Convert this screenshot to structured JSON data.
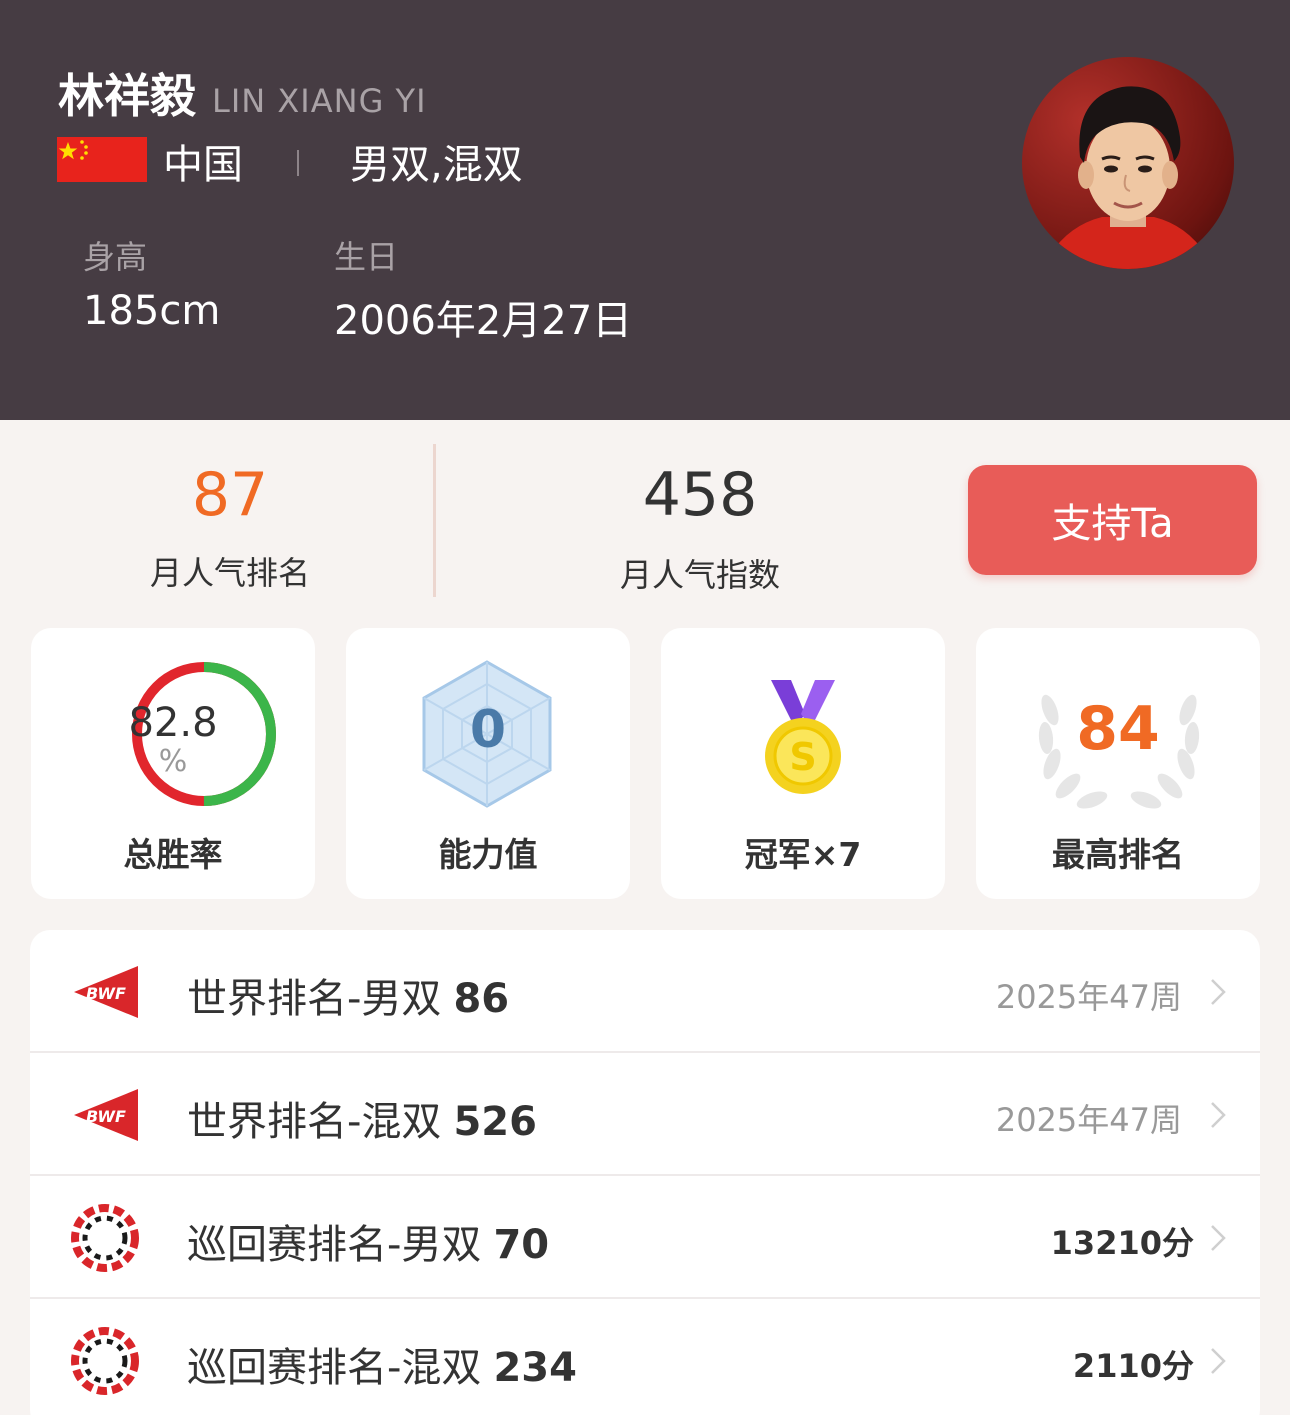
{
  "player": {
    "name_cn": "林祥毅",
    "name_en": "LIN XIANG YI",
    "country": "中国",
    "separator": "|",
    "events": "男双,混双",
    "height_label": "身高",
    "height_value": "185cm",
    "birthday_label": "生日",
    "birthday_value": "2006年2月27日"
  },
  "popularity": {
    "rank_value": "87",
    "rank_label": "月人气排名",
    "index_value": "458",
    "index_label": "月人气指数",
    "support_button": "支持Ta"
  },
  "stats": {
    "win_rate": {
      "value": "82.8",
      "unit": "%",
      "label": "总胜率",
      "fraction": 0.828
    },
    "ability": {
      "value": "0",
      "label": "能力值"
    },
    "champion": {
      "medal_letter": "S",
      "label": "冠军×7"
    },
    "best_rank": {
      "value": "84",
      "label": "最高排名"
    }
  },
  "rankings": [
    {
      "icon": "bwf-logo-icon",
      "title": "世界排名-男双",
      "number": "86",
      "meta": "2025年47周"
    },
    {
      "icon": "bwf-logo-icon",
      "title": "世界排名-混双",
      "number": "526",
      "meta": "2025年47周"
    },
    {
      "icon": "tour-logo-icon",
      "title": "巡回赛排名-男双",
      "number": "70",
      "meta": "13210分"
    },
    {
      "icon": "tour-logo-icon",
      "title": "巡回赛排名-混双",
      "number": "234",
      "meta": "2110分"
    }
  ],
  "colors": {
    "header_bg": "#463c43",
    "accent_orange": "#f06a24",
    "support_red": "#e85c58",
    "ring_red": "#e1262d",
    "ring_green": "#3cb54a"
  }
}
